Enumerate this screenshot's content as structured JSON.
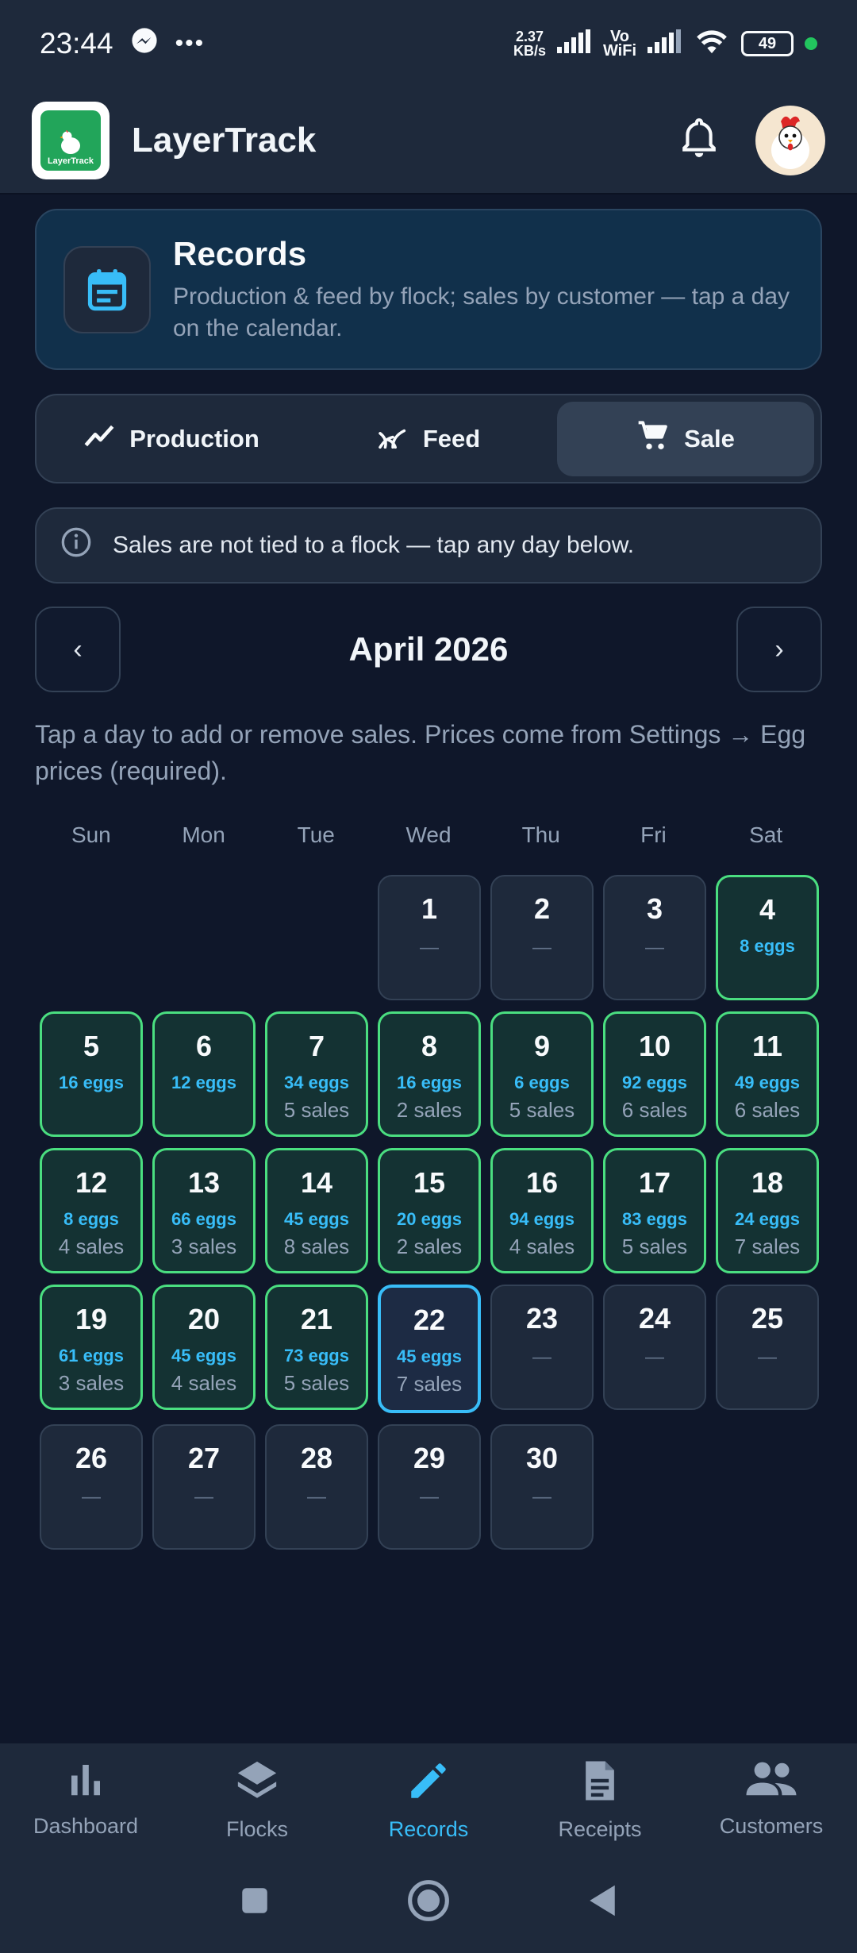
{
  "status": {
    "time": "23:44",
    "netspeed_top": "2.37",
    "netspeed_bottom": "KB/s",
    "vowifi_top": "Vo",
    "vowifi_bottom": "WiFi",
    "battery": "49"
  },
  "appbar": {
    "title": "LayerTrack",
    "logo_text": "LayerTrack"
  },
  "records": {
    "title": "Records",
    "subtitle": "Production & feed by flock; sales by customer — tap a day on the calendar."
  },
  "tabs": [
    {
      "label": "Production",
      "icon": "trending-line-icon"
    },
    {
      "label": "Feed",
      "icon": "grass-icon"
    },
    {
      "label": "Sale",
      "icon": "cart-icon"
    }
  ],
  "info": {
    "text": "Sales are not tied to a flock — tap any day below."
  },
  "month": {
    "title": "April 2026",
    "prev": "‹",
    "next": "›"
  },
  "hint": "Tap a day to add or remove sales. Prices come from Settings → Egg prices (required).",
  "weekdays": [
    "Sun",
    "Mon",
    "Tue",
    "Wed",
    "Thu",
    "Fri",
    "Sat"
  ],
  "calendar": {
    "days": [
      {
        "day": "1",
        "dash": "—"
      },
      {
        "day": "2",
        "dash": "—"
      },
      {
        "day": "3",
        "dash": "—"
      },
      {
        "day": "4",
        "eggs": "8 eggs"
      },
      {
        "day": "5",
        "eggs": "16 eggs"
      },
      {
        "day": "6",
        "eggs": "12 eggs"
      },
      {
        "day": "7",
        "eggs": "34 eggs",
        "sales": "5 sales"
      },
      {
        "day": "8",
        "eggs": "16 eggs",
        "sales": "2 sales"
      },
      {
        "day": "9",
        "eggs": "6 eggs",
        "sales": "5 sales"
      },
      {
        "day": "10",
        "eggs": "92 eggs",
        "sales": "6 sales"
      },
      {
        "day": "11",
        "eggs": "49 eggs",
        "sales": "6 sales"
      },
      {
        "day": "12",
        "eggs": "8 eggs",
        "sales": "4 sales"
      },
      {
        "day": "13",
        "eggs": "66 eggs",
        "sales": "3 sales"
      },
      {
        "day": "14",
        "eggs": "45 eggs",
        "sales": "8 sales"
      },
      {
        "day": "15",
        "eggs": "20 eggs",
        "sales": "2 sales"
      },
      {
        "day": "16",
        "eggs": "94 eggs",
        "sales": "4 sales"
      },
      {
        "day": "17",
        "eggs": "83 eggs",
        "sales": "5 sales"
      },
      {
        "day": "18",
        "eggs": "24 eggs",
        "sales": "7 sales"
      },
      {
        "day": "19",
        "eggs": "61 eggs",
        "sales": "3 sales"
      },
      {
        "day": "20",
        "eggs": "45 eggs",
        "sales": "4 sales"
      },
      {
        "day": "21",
        "eggs": "73 eggs",
        "sales": "5 sales"
      },
      {
        "day": "22",
        "eggs": "45 eggs",
        "sales": "7 sales",
        "today": true
      },
      {
        "day": "23",
        "dash": "—"
      },
      {
        "day": "24",
        "dash": "—"
      },
      {
        "day": "25",
        "dash": "—"
      },
      {
        "day": "26",
        "dash": "—"
      },
      {
        "day": "27",
        "dash": "—"
      },
      {
        "day": "28",
        "dash": "—"
      },
      {
        "day": "29",
        "dash": "—"
      },
      {
        "day": "30",
        "dash": "—"
      }
    ]
  },
  "bottomnav": [
    {
      "label": "Dashboard",
      "icon": "bar-chart-icon"
    },
    {
      "label": "Flocks",
      "icon": "layers-icon"
    },
    {
      "label": "Records",
      "icon": "pencil-icon",
      "active": true
    },
    {
      "label": "Receipts",
      "icon": "document-icon"
    },
    {
      "label": "Customers",
      "icon": "people-icon"
    }
  ],
  "colors": {
    "background": "#0f172a",
    "surface": "#1e293b",
    "accent": "#38bdf8",
    "success_border": "#4ade80"
  }
}
